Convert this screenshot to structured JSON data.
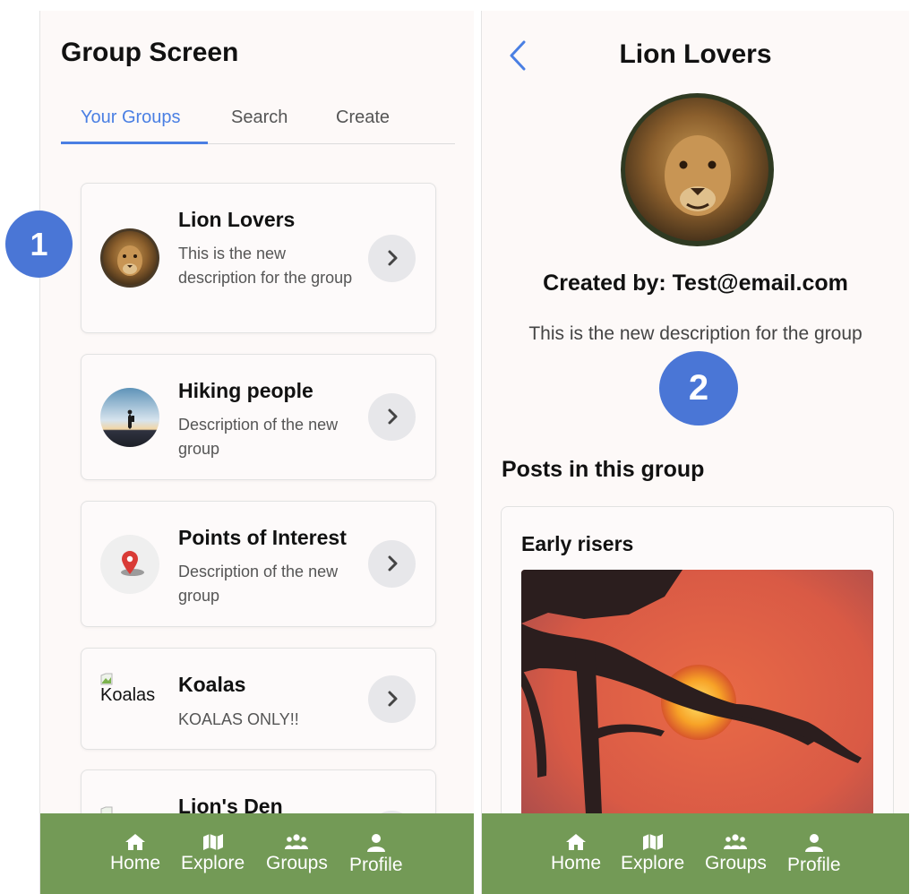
{
  "left_screen": {
    "title": "Group Screen",
    "tabs": [
      {
        "label": "Your Groups",
        "active": true
      },
      {
        "label": "Search",
        "active": false
      },
      {
        "label": "Create",
        "active": false
      }
    ],
    "groups": [
      {
        "name": "Lion Lovers",
        "description": "This is the new description for the group",
        "thumbnail": "lion-photo"
      },
      {
        "name": "Hiking people",
        "description": "Description of the new group",
        "thumbnail": "hiker-sunset-photo"
      },
      {
        "name": "Points of Interest",
        "description": "Description of the new group",
        "thumbnail": "map-pin-icon"
      },
      {
        "name": "Koalas",
        "description": "KOALAS ONLY!!",
        "thumbnail": "broken-image",
        "alt_text": "Koalas"
      },
      {
        "name": "Lion's Den",
        "description": "",
        "thumbnail": "broken-image"
      }
    ],
    "badge": "1"
  },
  "right_screen": {
    "title": "Lion Lovers",
    "created_by": "Created by: Test@email.com",
    "description": "This is the new description for the group",
    "badge": "2",
    "posts_heading": "Posts in this group",
    "posts": [
      {
        "title": "Early risers",
        "image": "acacia-tree-sunset-photo"
      }
    ]
  },
  "nav": [
    {
      "label": "Home",
      "icon": "home-icon"
    },
    {
      "label": "Explore",
      "icon": "map-icon"
    },
    {
      "label": "Groups",
      "icon": "users-icon"
    },
    {
      "label": "Profile",
      "icon": "user-icon"
    }
  ],
  "colors": {
    "accent": "#4a7fe3",
    "navbar": "#739a56",
    "badge": "#4a76d6",
    "screen_bg": "#fdf9f8"
  }
}
